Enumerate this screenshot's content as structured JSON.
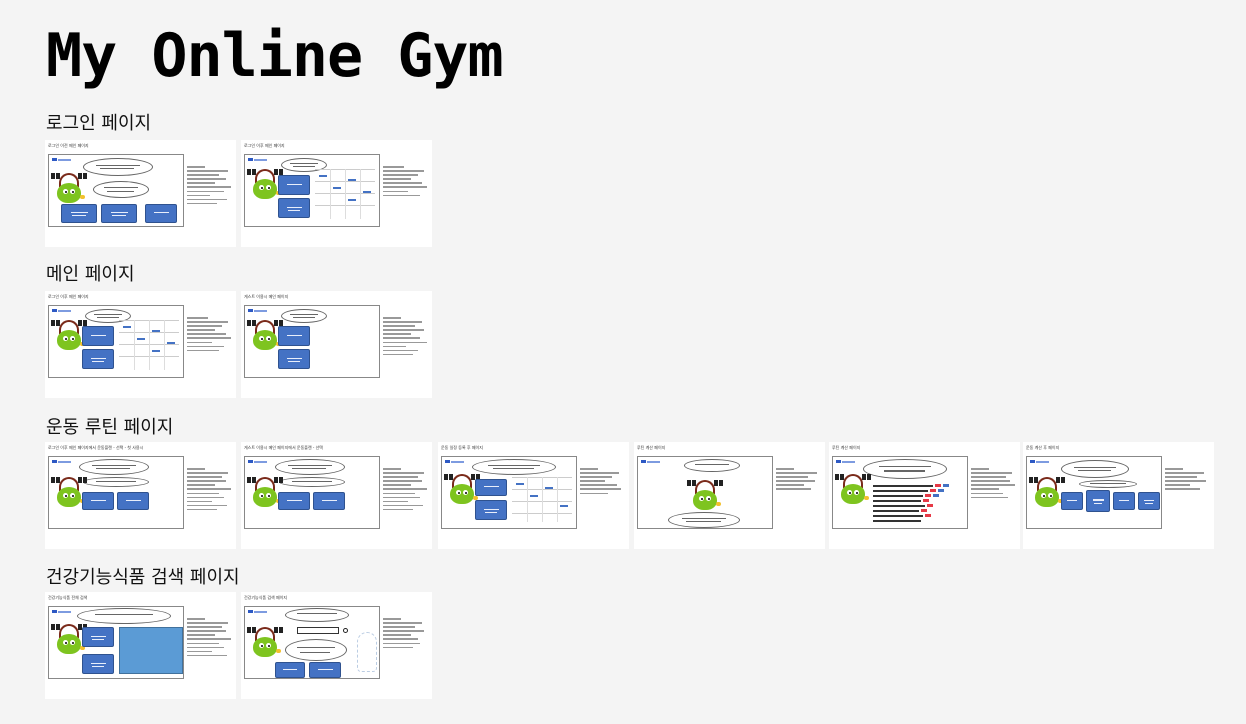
{
  "title": "My Online Gym",
  "sections": [
    {
      "title": "로그인 페이지",
      "cards": [
        "로그인 이전 메인 페이지",
        "로그인 이후 메인 페이지"
      ]
    },
    {
      "title": "메인 페이지",
      "cards": [
        "로그인 이후 메인 페이지",
        "게스트 이용시 메인 페이지"
      ]
    },
    {
      "title": "운동 루틴 페이지",
      "cards": [
        "로그인 이후 메인 페이지에서 운동플랜 - 선택 - 첫 사용시",
        "게스트 이용시 메인 페이지에서 운동플랜 - 선택",
        "운동 일정 등록 후 페이지",
        "루틴 계산 페이지",
        "루틴 계산 페이지",
        "운동 계산 후 페이지"
      ]
    },
    {
      "title": "건강기능식품 검색 페이지",
      "cards": [
        "건강기능식품 전체 검색",
        "건강기능식품 검색 페이지"
      ]
    }
  ]
}
